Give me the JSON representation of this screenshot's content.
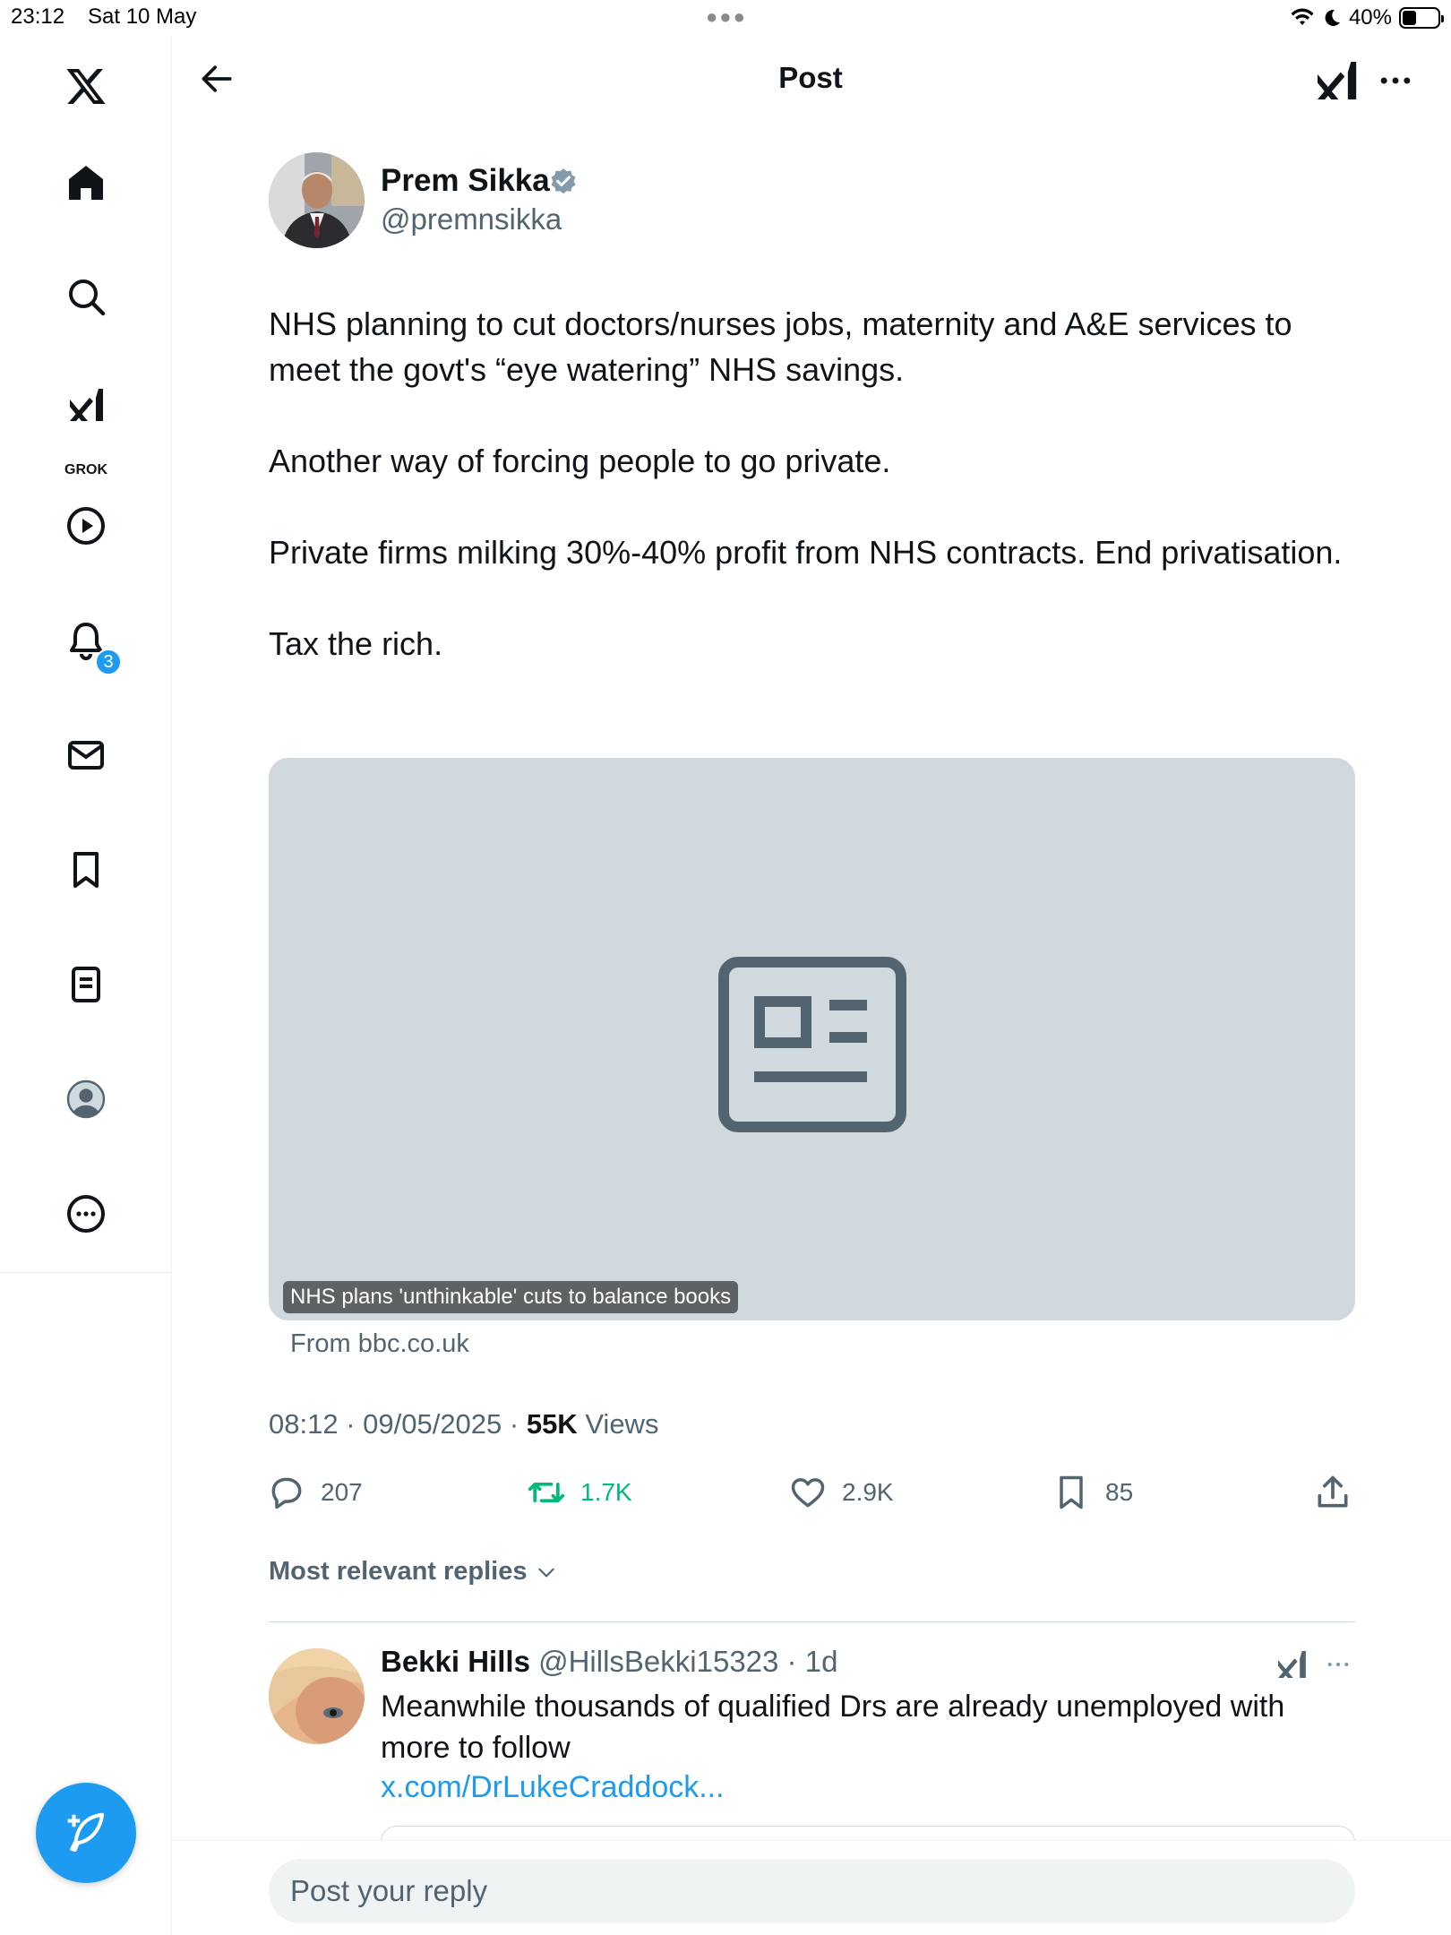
{
  "status_bar": {
    "time": "23:12",
    "date": "Sat 10 May",
    "battery": "40%",
    "battery_level": 0.4
  },
  "sidebar": {
    "items": [
      {
        "name": "x-logo-icon"
      },
      {
        "name": "home-icon"
      },
      {
        "name": "search-icon"
      },
      {
        "name": "grok-icon",
        "label": "GROK"
      },
      {
        "name": "video-play-icon"
      },
      {
        "name": "notifications-icon",
        "badge": "3"
      },
      {
        "name": "messages-icon"
      },
      {
        "name": "bookmarks-icon"
      },
      {
        "name": "lists-icon"
      },
      {
        "name": "profile-icon"
      },
      {
        "name": "more-icon"
      }
    ]
  },
  "header": {
    "title": "Post"
  },
  "post": {
    "author_name": "Prem Sikka",
    "author_handle": "@premnsikka",
    "paragraphs": [
      "NHS planning to cut doctors/nurses jobs, maternity and A&E services to meet the govt's “eye watering” NHS savings.",
      "Another way of forcing people to go private.",
      "Private firms milking 30%-40% profit from NHS contracts. End privatisation.",
      "Tax the rich."
    ],
    "card": {
      "title": "NHS plans 'unthinkable' cuts to balance books",
      "source": "From bbc.co.uk"
    },
    "timestamp": "08:12 · 09/05/2025 · ",
    "views_count": "55K",
    "views_label": " Views",
    "stats": {
      "replies": "207",
      "reposts": "1.7K",
      "likes": "2.9K",
      "bookmarks": "85"
    }
  },
  "replies_section": {
    "sort_label": "Most relevant replies"
  },
  "reply": {
    "name": "Bekki Hills",
    "handle": "@HillsBekki15323",
    "time": " · 1d",
    "text": "Meanwhile thousands of qualified Drs are already unemployed with more to follow",
    "link": "x.com/DrLukeCraddock..."
  },
  "composer": {
    "placeholder": "Post your reply"
  },
  "colors": {
    "accent": "#1d9bf0",
    "repost": "#00ba7c",
    "secondary_text": "#536471",
    "card_bg": "#cfd9de"
  }
}
